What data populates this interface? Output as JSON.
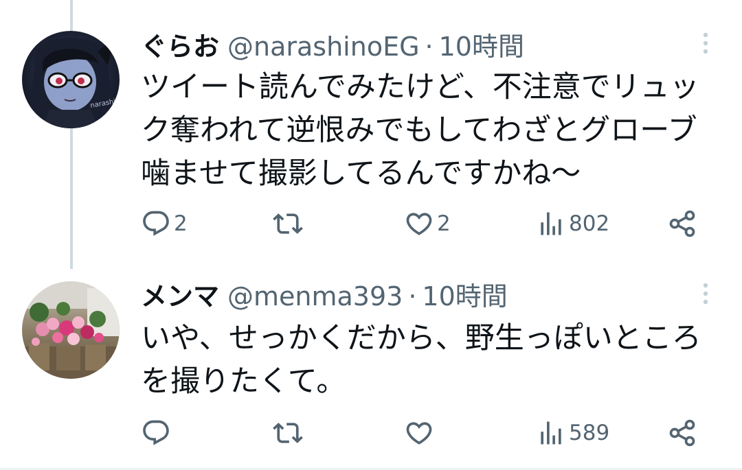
{
  "tweets": [
    {
      "name": "ぐらお",
      "handle": "@narashinoEG",
      "separator": "·",
      "time": "10時間",
      "text_lines": [
        "ツイート読んでみたけど、不注意でリュッ",
        "ク奪われて逆恨みでもしてわざとグローブ",
        "噛ませて撮影してるんですかね～"
      ],
      "avatar_watermark": "narashin",
      "replies": "2",
      "retweets": "",
      "likes": "2",
      "views": "802"
    },
    {
      "name": "メンマ",
      "handle": "@menma393",
      "separator": "·",
      "time": "10時間",
      "text_lines": [
        "いや、せっかくだから、野生っぽいところ",
        "を撮りたくて。"
      ],
      "replies": "",
      "retweets": "",
      "likes": "",
      "views": "589"
    }
  ],
  "icons": {
    "reply": "reply-icon",
    "retweet": "retweet-icon",
    "like": "heart-icon",
    "views": "views-chart-icon",
    "share": "share-icon",
    "more": "more-options-icon"
  },
  "colors": {
    "text_primary": "#0f1419",
    "text_secondary": "#536471",
    "thread_line": "#cfd9de",
    "divider": "#eff3f4"
  }
}
